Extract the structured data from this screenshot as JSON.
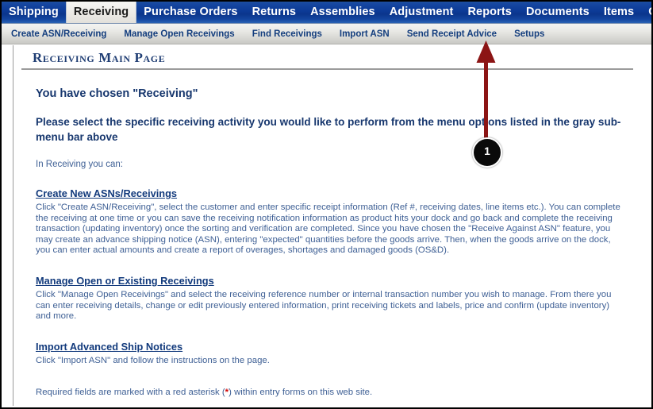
{
  "main_nav": {
    "items": [
      {
        "label": "Shipping",
        "active": false
      },
      {
        "label": "Receiving",
        "active": true
      },
      {
        "label": "Purchase Orders",
        "active": false
      },
      {
        "label": "Returns",
        "active": false
      },
      {
        "label": "Assemblies",
        "active": false
      },
      {
        "label": "Adjustment",
        "active": false
      },
      {
        "label": "Reports",
        "active": false
      },
      {
        "label": "Documents",
        "active": false
      },
      {
        "label": "Items",
        "active": false
      },
      {
        "label": "Customers",
        "active": false
      }
    ]
  },
  "sub_nav": {
    "items": [
      {
        "label": "Create ASN/Receiving"
      },
      {
        "label": "Manage Open Receivings"
      },
      {
        "label": "Find Receivings"
      },
      {
        "label": "Import ASN"
      },
      {
        "label": "Send Receipt Advice"
      },
      {
        "label": "Setups"
      }
    ]
  },
  "page": {
    "title": "Receiving Main Page",
    "heading": "You have chosen \"Receiving\"",
    "subheading": "Please select the specific receiving activity you would like to perform from the menu options listed in the gray sub-menu bar above",
    "intro": "In Receiving you can:",
    "footnote_before": "Required fields are marked with a red asterisk (",
    "footnote_asterisk": "*",
    "footnote_after": ") within entry forms on this web site."
  },
  "sections": [
    {
      "title": "Create New ASNs/Receivings",
      "body": "Click \"Create ASN/Receiving\", select the customer and enter specific receipt information (Ref #, receiving dates, line items etc.). You can complete the receiving at one time or you can save the receiving notification information as product hits your dock and go back and complete the receiving transaction (updating inventory) once the sorting and verification are completed. Since you have chosen the \"Receive Against ASN\" feature, you may create an advance shipping notice (ASN), entering \"expected\" quantities before the goods arrive. Then, when the goods arrive on the dock, you can enter actual amounts and create a report of overages, shortages and damaged goods (OS&D)."
    },
    {
      "title": "Manage Open or Existing Receivings",
      "body": "Click \"Manage Open Receivings\" and select the receiving reference number or internal transaction number you wish to manage. From there you can enter receiving details, change or edit previously entered information, print receiving tickets and labels, price and confirm (update inventory) and more."
    },
    {
      "title": "Import Advanced Ship Notices",
      "body": "Click \"Import ASN\" and follow the instructions on the page."
    }
  ],
  "annotation": {
    "badge_number": "1",
    "arrow_color": "#8c1515",
    "target_label": "Setups"
  },
  "colors": {
    "nav_blue": "#0c3a96",
    "link_blue": "#123a7c",
    "body_blue": "#3f6095",
    "heading_blue": "#17376e",
    "asterisk_red": "#d00000",
    "annotation_red": "#8c1515"
  }
}
